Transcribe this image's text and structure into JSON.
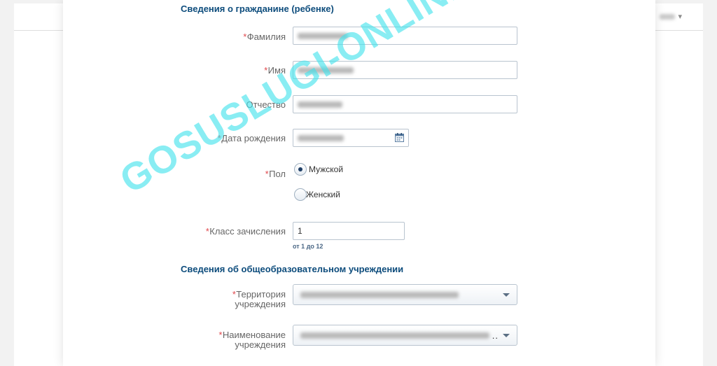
{
  "sections": {
    "citizen": "Сведения о гражданине (ребенке)",
    "school": "Сведения об общеобразовательном учреждении"
  },
  "required_mark": "*",
  "fields": {
    "last_name": {
      "label": "Фамилия",
      "required": true
    },
    "first_name": {
      "label": "Имя",
      "required": true
    },
    "patronymic": {
      "label": "Отчество",
      "required": false
    },
    "birth_date": {
      "label": "Дата рождения",
      "required": true
    },
    "gender": {
      "label": "Пол",
      "required": true,
      "options": [
        "Мужской",
        "Женский"
      ],
      "selected": "Мужской"
    },
    "grade": {
      "label": "Класс зачисления",
      "required": true,
      "value": "1",
      "hint": "от 1 до 12"
    },
    "territory": {
      "label_line1": "Территория",
      "label_line2": "учреждения",
      "required": true
    },
    "institution": {
      "label_line1": "Наименование",
      "label_line2": "учреждения",
      "required": true,
      "truncation": ".."
    }
  },
  "icons": {
    "calendar": "calendar-icon",
    "dropdown": "chevron-down-icon"
  },
  "colors": {
    "section_title": "#0d4c7c",
    "required": "#e0474c",
    "label": "#666666",
    "watermark": "#40e2ec"
  },
  "watermark": "GOSUSLUGI-ONLINE.RU"
}
